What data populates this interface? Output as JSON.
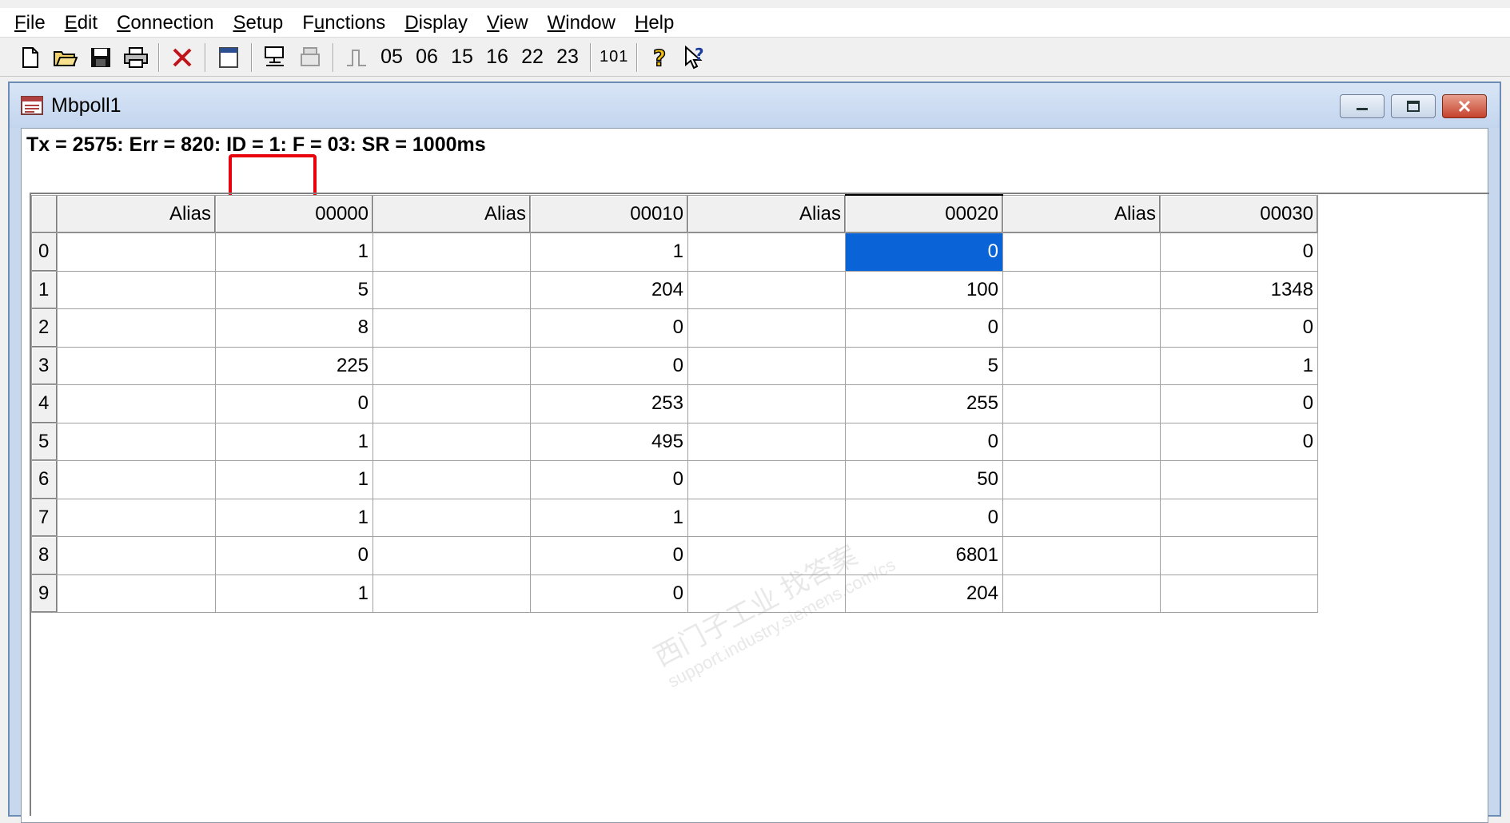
{
  "menu": [
    {
      "accel": "F",
      "rest": "ile"
    },
    {
      "accel": "E",
      "rest": "dit"
    },
    {
      "accel": "C",
      "rest": "onnection"
    },
    {
      "accel": "S",
      "rest": "etup"
    },
    {
      "pre": "F",
      "accel": "u",
      "rest": "nctions"
    },
    {
      "accel": "D",
      "rest": "isplay"
    },
    {
      "accel": "V",
      "rest": "iew"
    },
    {
      "accel": "W",
      "rest": "indow"
    },
    {
      "accel": "H",
      "rest": "elp"
    }
  ],
  "toolbar": {
    "functions": [
      "05",
      "06",
      "15",
      "16",
      "22",
      "23"
    ],
    "f101": "101"
  },
  "window": {
    "title": "Mbpoll1"
  },
  "status": "Tx = 2575: Err = 820: ID = 1: F = 03: SR = 1000ms",
  "grid": {
    "headers": [
      "Alias",
      "00000",
      "Alias",
      "00010",
      "Alias",
      "00020",
      "Alias",
      "00030"
    ],
    "rows": [
      {
        "index": "0",
        "cells": [
          "",
          "1",
          "",
          "1",
          "",
          "0",
          "",
          "0"
        ]
      },
      {
        "index": "1",
        "cells": [
          "",
          "5",
          "",
          "204",
          "",
          "100",
          "",
          "1348"
        ]
      },
      {
        "index": "2",
        "cells": [
          "",
          "8",
          "",
          "0",
          "",
          "0",
          "",
          "0"
        ]
      },
      {
        "index": "3",
        "cells": [
          "",
          "225",
          "",
          "0",
          "",
          "5",
          "",
          "1"
        ]
      },
      {
        "index": "4",
        "cells": [
          "",
          "0",
          "",
          "253",
          "",
          "255",
          "",
          "0"
        ]
      },
      {
        "index": "5",
        "cells": [
          "",
          "1",
          "",
          "495",
          "",
          "0",
          "",
          "0"
        ]
      },
      {
        "index": "6",
        "cells": [
          "",
          "1",
          "",
          "0",
          "",
          "50",
          "",
          ""
        ]
      },
      {
        "index": "7",
        "cells": [
          "",
          "1",
          "",
          "1",
          "",
          "0",
          "",
          ""
        ]
      },
      {
        "index": "8",
        "cells": [
          "",
          "0",
          "",
          "0",
          "",
          "6801",
          "",
          ""
        ]
      },
      {
        "index": "9",
        "cells": [
          "",
          "1",
          "",
          "0",
          "",
          "204",
          "",
          ""
        ]
      }
    ]
  },
  "watermark": {
    "line1": "西门子工业 找答案",
    "line2": "support.industry.siemens.com/cs"
  },
  "colors": {
    "selection": "#0a64d8",
    "highlight_box": "#e8000b",
    "title_bar": "#c6d7ee"
  }
}
